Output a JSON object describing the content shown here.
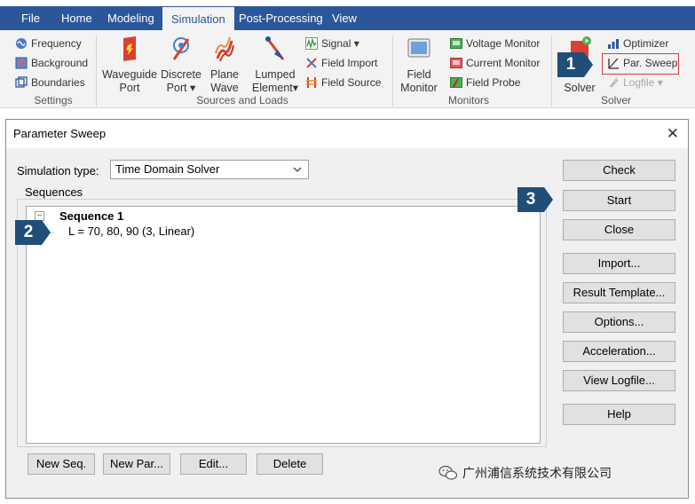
{
  "ribbon": {
    "tabs": [
      {
        "label": "File",
        "active": false
      },
      {
        "label": "Home",
        "active": false
      },
      {
        "label": "Modeling",
        "active": false
      },
      {
        "label": "Simulation",
        "active": true
      },
      {
        "label": "Post-Processing",
        "active": false
      },
      {
        "label": "View",
        "active": false
      }
    ],
    "settings": {
      "frequency": "Frequency",
      "background": "Background",
      "boundaries": "Boundaries",
      "group_label": "Settings"
    },
    "sources": {
      "waveguide_port": [
        "Waveguide",
        "Port"
      ],
      "discrete_port": [
        "Discrete",
        "Port ▾"
      ],
      "plane_wave": [
        "Plane",
        "Wave"
      ],
      "lumped_element": [
        "Lumped",
        "Element▾"
      ],
      "signal": "Signal ▾",
      "field_import": "Field Import",
      "field_source": "Field Source",
      "group_label": "Sources and Loads"
    },
    "monitors": {
      "field_monitor": [
        "Field",
        "Monitor"
      ],
      "voltage_monitor": "Voltage Monitor",
      "current_monitor": "Current Monitor",
      "field_probe": "Field Probe",
      "group_label": "Monitors"
    },
    "solver": {
      "solver": "Solver",
      "optimizer": "Optimizer",
      "par_sweep": "Par. Sweep",
      "logfile": "Logfile ▾",
      "group_label": "Solver"
    }
  },
  "callouts": {
    "one": "1",
    "two": "2",
    "three": "3"
  },
  "dialog": {
    "title": "Parameter Sweep",
    "close_glyph": "✕",
    "simulation_type_label": "Simulation type:",
    "simulation_type_value": "Time Domain Solver",
    "sequences_label": "Sequences",
    "tree": {
      "toggle": "−",
      "sequence": "Sequence 1",
      "parameter": "L = 70, 80, 90 (3, Linear)"
    },
    "right_buttons": {
      "check": "Check",
      "start": "Start",
      "close": "Close",
      "import": "Import...",
      "result_template": "Result Template...",
      "options": "Options...",
      "acceleration": "Acceleration...",
      "view_logfile": "View Logfile...",
      "help": "Help"
    },
    "bottom_buttons": {
      "new_seq": "New Seq.",
      "new_par": "New Par...",
      "edit": "Edit...",
      "delete": "Delete"
    }
  },
  "watermark": {
    "text": "广州浦信系统技术有限公司"
  },
  "colors": {
    "ribbon_blue": "#2b579a",
    "callout_navy": "#1f4e79",
    "highlight_red": "#e0393e"
  }
}
